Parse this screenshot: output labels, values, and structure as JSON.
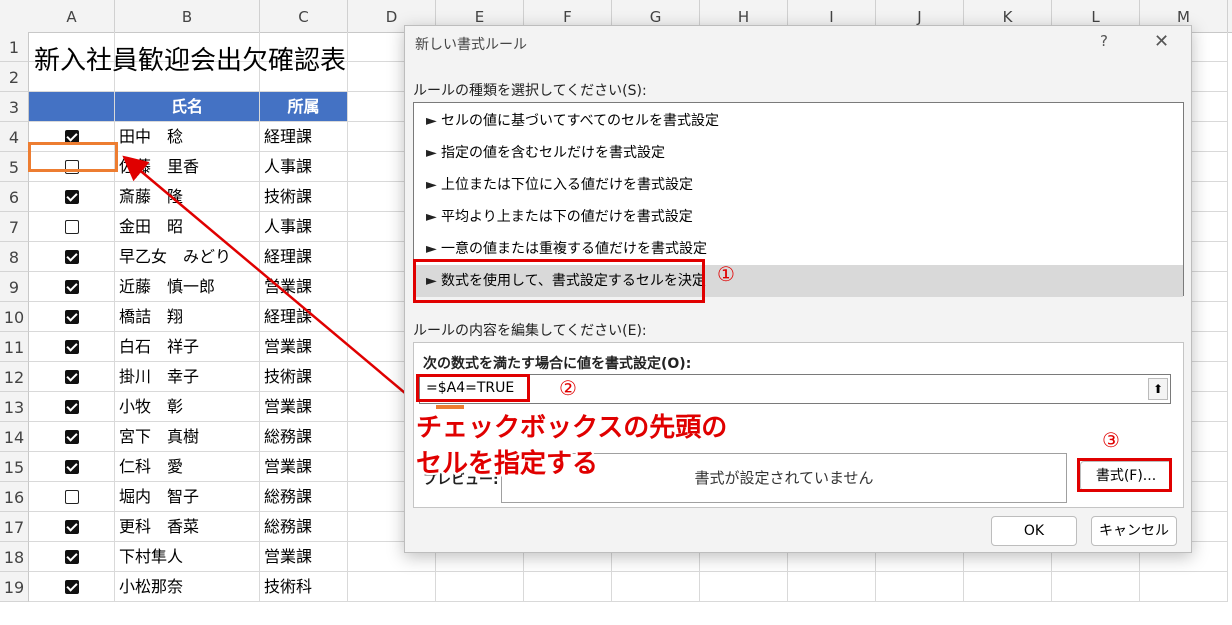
{
  "sheet": {
    "columns": [
      "A",
      "B",
      "C",
      "D",
      "E",
      "F",
      "G",
      "H",
      "I",
      "J",
      "K",
      "L",
      "M"
    ],
    "rows": [
      "1",
      "2",
      "3",
      "4",
      "5",
      "6",
      "7",
      "8",
      "9",
      "10",
      "11",
      "12",
      "13",
      "14",
      "15",
      "16",
      "17",
      "18",
      "19"
    ],
    "title": "新入社員歓迎会出欠確認表",
    "header": {
      "name": "氏名",
      "dept": "所属"
    },
    "records": [
      {
        "checked": true,
        "name": "田中　稔",
        "dept": "経理課"
      },
      {
        "checked": false,
        "name": "佐藤　里香",
        "dept": "人事課"
      },
      {
        "checked": true,
        "name": "斎藤　隆",
        "dept": "技術課"
      },
      {
        "checked": false,
        "name": "金田　昭",
        "dept": "人事課"
      },
      {
        "checked": true,
        "name": "早乙女　みどり",
        "dept": "経理課"
      },
      {
        "checked": true,
        "name": "近藤　慎一郎",
        "dept": "営業課"
      },
      {
        "checked": true,
        "name": "橋詰　翔",
        "dept": "経理課"
      },
      {
        "checked": true,
        "name": "白石　祥子",
        "dept": "営業課"
      },
      {
        "checked": true,
        "name": "掛川　幸子",
        "dept": "技術課"
      },
      {
        "checked": true,
        "name": "小牧　彰",
        "dept": "営業課"
      },
      {
        "checked": true,
        "name": "宮下　真樹",
        "dept": "総務課"
      },
      {
        "checked": true,
        "name": "仁科　愛",
        "dept": "営業課"
      },
      {
        "checked": false,
        "name": "堀内　智子",
        "dept": "総務課"
      },
      {
        "checked": true,
        "name": "更科　香菜",
        "dept": "総務課"
      },
      {
        "checked": true,
        "name": "下村隼人",
        "dept": "営業課"
      },
      {
        "checked": true,
        "name": "小松那奈",
        "dept": "技術科"
      }
    ]
  },
  "dialog": {
    "title": "新しい書式ルール",
    "help": "?",
    "close": "✕",
    "rule_type_label": "ルールの種類を選択してください(S):",
    "rule_types": [
      "セルの値に基づいてすべてのセルを書式設定",
      "指定の値を含むセルだけを書式設定",
      "上位または下位に入る値だけを書式設定",
      "平均より上または下の値だけを書式設定",
      "一意の値または重複する値だけを書式設定",
      "数式を使用して、書式設定するセルを決定"
    ],
    "rule_arrow": "►",
    "edit_label": "ルールの内容を編集してください(E):",
    "formula_label": "次の数式を満たす場合に値を書式設定(O):",
    "formula_value": "=$A4=TRUE",
    "collapse_icon": "⬆",
    "preview_label": "プレビュー:",
    "preview_text": "書式が設定されていません",
    "format_button": "書式(F)...",
    "ok_button": "OK",
    "cancel_button": "キャンセル"
  },
  "annotations": {
    "step1": "①",
    "step2": "②",
    "step3": "③",
    "callout_line1": "チェックボックスの先頭の",
    "callout_line2": "セルを指定する",
    "accent_red": "#e00000",
    "accent_orange": "#ed7d31"
  }
}
